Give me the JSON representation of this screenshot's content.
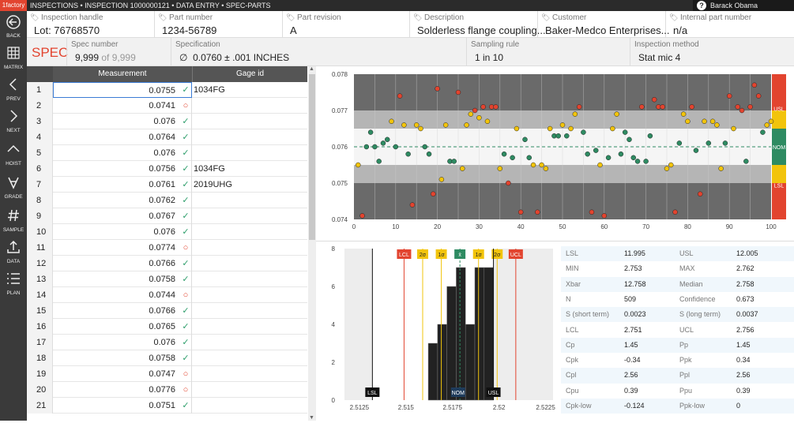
{
  "app": {
    "logo": "1factory",
    "breadcrumb": "INSPECTIONS • INSPECTION 1000000121 • DATA ENTRY • SPEC-PARTS",
    "user": "Barack Obama"
  },
  "sidebar": [
    {
      "label": "BACK",
      "icon": "back-icon"
    },
    {
      "label": "MATRIX",
      "icon": "grid-icon"
    },
    {
      "label": "PREV",
      "icon": "chevron-left-icon"
    },
    {
      "label": "NEXT",
      "icon": "chevron-right-icon"
    },
    {
      "label": "HOIST",
      "icon": "chevron-up-icon"
    },
    {
      "label": "GRADE",
      "icon": "grade-icon"
    },
    {
      "label": "SAMPLE",
      "icon": "hash-icon"
    },
    {
      "label": "DATA",
      "icon": "upload-icon"
    },
    {
      "label": "PLAN",
      "icon": "plan-icon"
    }
  ],
  "header": [
    {
      "label": "Inspection handle",
      "value": "Lot: 76768570"
    },
    {
      "label": "Part number",
      "value": "1234-56789"
    },
    {
      "label": "Part revision",
      "value": "A"
    },
    {
      "label": "Description",
      "value": "Solderless flange coupling..."
    },
    {
      "label": "Customer",
      "value": "Baker-Medco Enterprises..."
    },
    {
      "label": "Internal part number",
      "value": "n/a"
    }
  ],
  "spec": {
    "title": "SPEC",
    "spec_number_label": "Spec number",
    "spec_number": "9,999",
    "spec_number_of": "of 9,999",
    "specification_label": "Specification",
    "diameter_symbol": "∅",
    "specification": "0.0760 ± .001 INCHES",
    "sampling_label": "Sampling rule",
    "sampling": "1 in 10",
    "method_label": "Inspection method",
    "method": "Stat mic 4"
  },
  "table": {
    "headers": [
      "Measurement",
      "Gage id"
    ],
    "rows": [
      {
        "n": "1",
        "m": "0.0755",
        "ok": true,
        "g": "1034FG"
      },
      {
        "n": "2",
        "m": "0.0741",
        "ok": false,
        "g": ""
      },
      {
        "n": "3",
        "m": "0.076",
        "ok": true,
        "g": ""
      },
      {
        "n": "4",
        "m": "0.0764",
        "ok": true,
        "g": ""
      },
      {
        "n": "5",
        "m": "0.076",
        "ok": true,
        "g": ""
      },
      {
        "n": "6",
        "m": "0.0756",
        "ok": true,
        "g": "1034FG"
      },
      {
        "n": "7",
        "m": "0.0761",
        "ok": true,
        "g": "2019UHG"
      },
      {
        "n": "8",
        "m": "0.0762",
        "ok": true,
        "g": ""
      },
      {
        "n": "9",
        "m": "0.0767",
        "ok": true,
        "g": ""
      },
      {
        "n": "10",
        "m": "0.076",
        "ok": true,
        "g": ""
      },
      {
        "n": "11",
        "m": "0.0774",
        "ok": false,
        "g": ""
      },
      {
        "n": "12",
        "m": "0.0766",
        "ok": true,
        "g": ""
      },
      {
        "n": "13",
        "m": "0.0758",
        "ok": true,
        "g": ""
      },
      {
        "n": "14",
        "m": "0.0744",
        "ok": false,
        "g": ""
      },
      {
        "n": "15",
        "m": "0.0766",
        "ok": true,
        "g": ""
      },
      {
        "n": "16",
        "m": "0.0765",
        "ok": true,
        "g": ""
      },
      {
        "n": "17",
        "m": "0.076",
        "ok": true,
        "g": ""
      },
      {
        "n": "18",
        "m": "0.0758",
        "ok": true,
        "g": ""
      },
      {
        "n": "19",
        "m": "0.0747",
        "ok": false,
        "g": ""
      },
      {
        "n": "20",
        "m": "0.0776",
        "ok": false,
        "g": ""
      },
      {
        "n": "21",
        "m": "0.0751",
        "ok": true,
        "g": ""
      }
    ]
  },
  "chart_data": [
    {
      "type": "scatter",
      "y_ticks": [
        "0.078",
        "0.077",
        "0.076",
        "0.075",
        "0.074"
      ],
      "x_ticks": [
        "0",
        "10",
        "20",
        "30",
        "40",
        "50",
        "60",
        "70",
        "80",
        "90",
        "100"
      ],
      "ylim": [
        0.074,
        0.078
      ],
      "xlim": [
        0,
        100
      ],
      "band_labels": [
        "USL",
        "NOM",
        "LSL"
      ],
      "colors": {
        "in": "#2e8b62",
        "warn": "#f2c40c",
        "out": "#e2442f"
      },
      "points": [
        [
          1,
          0.0755
        ],
        [
          2,
          0.0741
        ],
        [
          3,
          0.076
        ],
        [
          4,
          0.0764
        ],
        [
          5,
          0.076
        ],
        [
          6,
          0.0756
        ],
        [
          7,
          0.0761
        ],
        [
          8,
          0.0762
        ],
        [
          9,
          0.0767
        ],
        [
          10,
          0.076
        ],
        [
          11,
          0.0774
        ],
        [
          12,
          0.0766
        ],
        [
          13,
          0.0758
        ],
        [
          14,
          0.0744
        ],
        [
          15,
          0.0766
        ],
        [
          16,
          0.0765
        ],
        [
          17,
          0.076
        ],
        [
          18,
          0.0758
        ],
        [
          19,
          0.0747
        ],
        [
          20,
          0.0776
        ],
        [
          21,
          0.0751
        ],
        [
          22,
          0.0766
        ],
        [
          23,
          0.0756
        ],
        [
          24,
          0.0756
        ],
        [
          25,
          0.0775
        ],
        [
          26,
          0.0754
        ],
        [
          27,
          0.0766
        ],
        [
          28,
          0.0769
        ],
        [
          29,
          0.077
        ],
        [
          30,
          0.0768
        ],
        [
          31,
          0.0771
        ],
        [
          32,
          0.0767
        ],
        [
          33,
          0.0771
        ],
        [
          34,
          0.0771
        ],
        [
          35,
          0.0754
        ],
        [
          36,
          0.0758
        ],
        [
          37,
          0.075
        ],
        [
          38,
          0.0757
        ],
        [
          39,
          0.0765
        ],
        [
          40,
          0.0742
        ],
        [
          41,
          0.0762
        ],
        [
          42,
          0.0757
        ],
        [
          43,
          0.0755
        ],
        [
          44,
          0.0742
        ],
        [
          45,
          0.0755
        ],
        [
          46,
          0.0754
        ],
        [
          47,
          0.0765
        ],
        [
          48,
          0.0763
        ],
        [
          49,
          0.0763
        ],
        [
          50,
          0.0766
        ],
        [
          51,
          0.0763
        ],
        [
          52,
          0.0765
        ],
        [
          53,
          0.0769
        ],
        [
          54,
          0.0771
        ],
        [
          55,
          0.0764
        ],
        [
          56,
          0.0758
        ],
        [
          57,
          0.0742
        ],
        [
          58,
          0.0759
        ],
        [
          59,
          0.0755
        ],
        [
          60,
          0.0741
        ],
        [
          61,
          0.0757
        ],
        [
          62,
          0.0765
        ],
        [
          63,
          0.0769
        ],
        [
          64,
          0.0758
        ],
        [
          65,
          0.0764
        ],
        [
          66,
          0.0762
        ],
        [
          67,
          0.0757
        ],
        [
          68,
          0.0756
        ],
        [
          69,
          0.0771
        ],
        [
          70,
          0.0756
        ],
        [
          71,
          0.0763
        ],
        [
          72,
          0.0773
        ],
        [
          73,
          0.0771
        ],
        [
          74,
          0.0771
        ],
        [
          75,
          0.0754
        ],
        [
          76,
          0.0755
        ],
        [
          77,
          0.0742
        ],
        [
          78,
          0.0761
        ],
        [
          79,
          0.0769
        ],
        [
          80,
          0.0767
        ],
        [
          81,
          0.0771
        ],
        [
          82,
          0.0759
        ],
        [
          83,
          0.0747
        ],
        [
          84,
          0.0767
        ],
        [
          85,
          0.0761
        ],
        [
          86,
          0.0767
        ],
        [
          87,
          0.0766
        ],
        [
          88,
          0.0754
        ],
        [
          89,
          0.0761
        ],
        [
          90,
          0.0774
        ],
        [
          91,
          0.0765
        ],
        [
          92,
          0.0771
        ],
        [
          93,
          0.077
        ],
        [
          94,
          0.0756
        ],
        [
          95,
          0.0771
        ],
        [
          96,
          0.0777
        ],
        [
          97,
          0.0774
        ],
        [
          98,
          0.0764
        ],
        [
          99,
          0.0766
        ],
        [
          100,
          0.0767
        ]
      ]
    },
    {
      "type": "bar",
      "x_ticks": [
        "2.5125",
        "2.515",
        "2.5175",
        "2.52",
        "2.5225"
      ],
      "y_ticks": [
        "8",
        "6",
        "4",
        "2",
        "0"
      ],
      "xlim": [
        2.5117,
        2.5229
      ],
      "ylim": [
        0,
        8
      ],
      "bins": [
        [
          2.5162,
          2.5167,
          3
        ],
        [
          2.5167,
          2.5172,
          4
        ],
        [
          2.5172,
          2.5177,
          6
        ],
        [
          2.5177,
          2.5182,
          7
        ],
        [
          2.5182,
          2.5187,
          4
        ],
        [
          2.5187,
          2.5192,
          7
        ],
        [
          2.5192,
          2.5197,
          7
        ]
      ],
      "markers": [
        {
          "label": "LSL",
          "x": 2.5132,
          "color": "#111111",
          "pos": "bottom"
        },
        {
          "label": "LCL",
          "x": 2.5149,
          "color": "#e2442f",
          "pos": "top"
        },
        {
          "label": "2σ",
          "x": 2.5159,
          "color": "#f2c40c",
          "pos": "top"
        },
        {
          "label": "1σ",
          "x": 2.5169,
          "color": "#f2c40c",
          "pos": "top"
        },
        {
          "label": "x̄",
          "x": 2.5179,
          "color": "#2e8b62",
          "pos": "top"
        },
        {
          "label": "NOM",
          "x": 2.5178,
          "color": "#1f3c5c",
          "pos": "bottom"
        },
        {
          "label": "1σ",
          "x": 2.5189,
          "color": "#f2c40c",
          "pos": "top"
        },
        {
          "label": "2σ",
          "x": 2.5199,
          "color": "#f2c40c",
          "pos": "top"
        },
        {
          "label": "UCL",
          "x": 2.5209,
          "color": "#e2442f",
          "pos": "top"
        },
        {
          "label": "USL",
          "x": 2.5197,
          "color": "#111111",
          "pos": "bottom"
        }
      ]
    }
  ],
  "stats": [
    [
      "LSL",
      "11.995",
      "USL",
      "12.005"
    ],
    [
      "MIN",
      "2.753",
      "MAX",
      "2.762"
    ],
    [
      "Xbar",
      "12.758",
      "Median",
      "2.758"
    ],
    [
      "N",
      "509",
      "Confidence",
      "0.673"
    ],
    [
      "S (short term)",
      "0.0023",
      "S (long term)",
      "0.0037"
    ],
    [
      "LCL",
      "2.751",
      "UCL",
      "2.756"
    ],
    [
      "Cp",
      "1.45",
      "Pp",
      "1.45"
    ],
    [
      "Cpk",
      "-0.34",
      "Ppk",
      "0.34"
    ],
    [
      "Cpl",
      "2.56",
      "Ppl",
      "2.56"
    ],
    [
      "Cpu",
      "0.39",
      "Ppu",
      "0.39"
    ],
    [
      "Cpk-low",
      "-0.124",
      "Ppk-low",
      "0"
    ]
  ]
}
